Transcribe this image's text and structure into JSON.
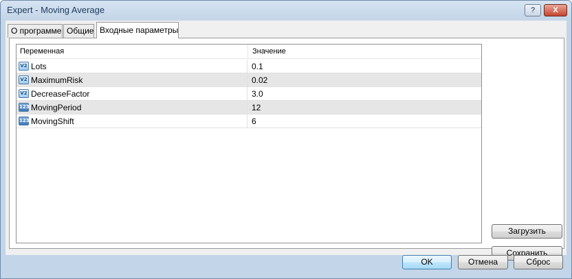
{
  "window": {
    "title": "Expert - Moving Average",
    "help_label": "?",
    "close_label": "X"
  },
  "tabs": [
    {
      "label": "О программе"
    },
    {
      "label": "Общие"
    },
    {
      "label": "Входные параметры",
      "active": true
    }
  ],
  "table": {
    "columns": [
      "Переменная",
      "Значение"
    ],
    "rows": [
      {
        "icon": "double-value-icon",
        "icon_text": "V2",
        "name": "Lots",
        "value": "0.1"
      },
      {
        "icon": "double-value-icon",
        "icon_text": "V2",
        "name": "MaximumRisk",
        "value": "0.02"
      },
      {
        "icon": "double-value-icon",
        "icon_text": "V2",
        "name": "DecreaseFactor",
        "value": "3.0"
      },
      {
        "icon": "integer-value-icon",
        "icon_text": "123",
        "name": "MovingPeriod",
        "value": "12"
      },
      {
        "icon": "integer-value-icon",
        "icon_text": "123",
        "name": "MovingShift",
        "value": "6"
      }
    ]
  },
  "side_buttons": {
    "load": "Загрузить",
    "save": "Сохранить"
  },
  "footer_buttons": {
    "ok": "OK",
    "cancel": "Отмена",
    "reset": "Сброс"
  }
}
